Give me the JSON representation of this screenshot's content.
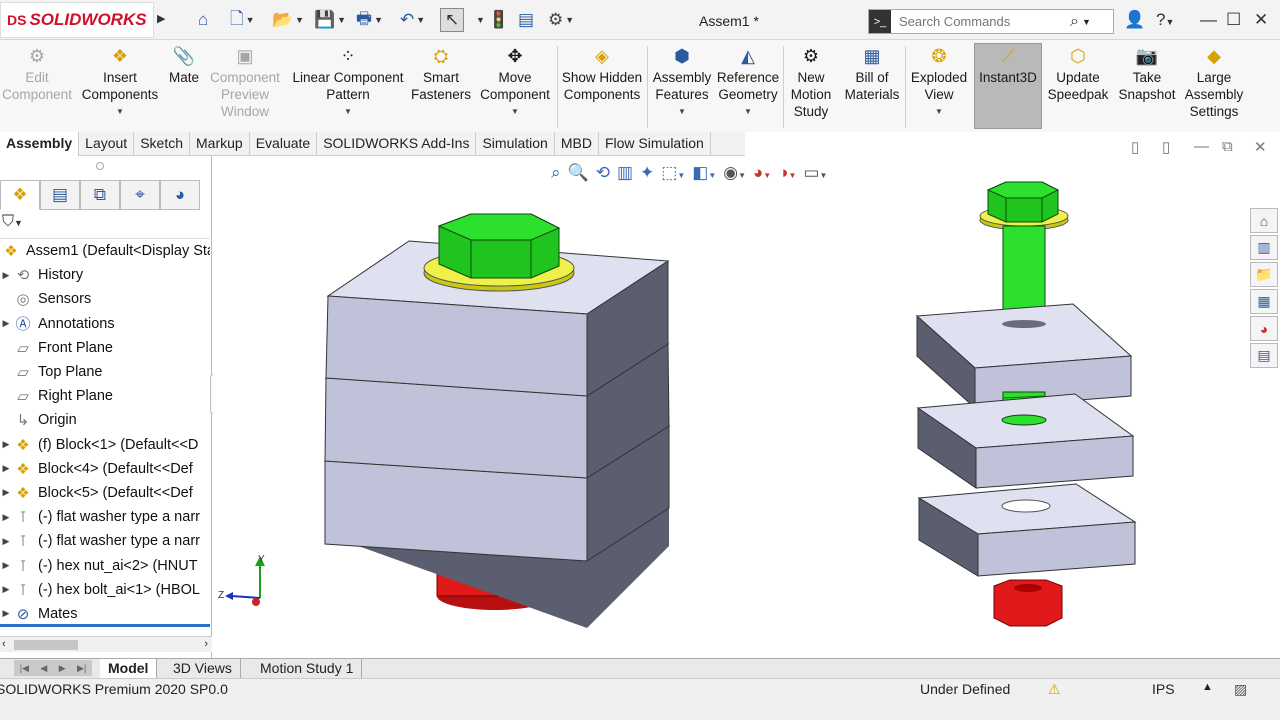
{
  "app": {
    "brand": "SOLIDWORKS",
    "doc_title": "Assem1 *"
  },
  "search": {
    "placeholder": "Search Commands"
  },
  "ribbon": {
    "edit_component": "Edit Component",
    "insert_components": "Insert Components",
    "mate": "Mate",
    "component_preview": "Component Preview Window",
    "linear_pattern": "Linear Component Pattern",
    "smart_fasteners": "Smart Fasteners",
    "move_component": "Move Component",
    "show_hidden": "Show Hidden Components",
    "assembly_features": "Assembly Features",
    "reference_geometry": "Reference Geometry",
    "new_motion_study": "New Motion Study",
    "bill_of_materials": "Bill of Materials",
    "exploded_view": "Exploded View",
    "instant3d": "Instant3D",
    "update_speedpak": "Update Speedpak",
    "take_snapshot": "Take Snapshot",
    "large_assembly": "Large Assembly Settings"
  },
  "tabs": [
    "Assembly",
    "Layout",
    "Sketch",
    "Markup",
    "Evaluate",
    "SOLIDWORKS Add-Ins",
    "Simulation",
    "MBD",
    "Flow Simulation"
  ],
  "tree": {
    "root": "Assem1  (Default<Display Sta",
    "items": [
      {
        "label": "History",
        "icon": "history-icon",
        "exp": true
      },
      {
        "label": "Sensors",
        "icon": "sensor-icon",
        "exp": false
      },
      {
        "label": "Annotations",
        "icon": "annotation-icon",
        "exp": true
      },
      {
        "label": "Front Plane",
        "icon": "plane-icon",
        "exp": false
      },
      {
        "label": "Top Plane",
        "icon": "plane-icon",
        "exp": false
      },
      {
        "label": "Right Plane",
        "icon": "plane-icon",
        "exp": false
      },
      {
        "label": "Origin",
        "icon": "origin-icon",
        "exp": false
      },
      {
        "label": "(f) Block<1> (Default<<D",
        "icon": "part-icon",
        "exp": true
      },
      {
        "label": "Block<4> (Default<<Def",
        "icon": "part-icon",
        "exp": true
      },
      {
        "label": "Block<5> (Default<<Def",
        "icon": "part-icon",
        "exp": true
      },
      {
        "label": "(-) flat washer type a narr",
        "icon": "toolbox-part-icon",
        "exp": true
      },
      {
        "label": "(-) flat washer type a narr",
        "icon": "toolbox-part-icon",
        "exp": true
      },
      {
        "label": "(-) hex nut_ai<2> (HNUT",
        "icon": "toolbox-part-icon",
        "exp": true
      },
      {
        "label": "(-) hex bolt_ai<1> (HBOL",
        "icon": "toolbox-part-icon",
        "exp": true
      },
      {
        "label": "Mates",
        "icon": "mates-icon",
        "exp": true
      }
    ]
  },
  "triad": {
    "x_label": "Z",
    "y_label": "Y"
  },
  "bottom_tabs": [
    "Model",
    "3D Views",
    "Motion Study 1"
  ],
  "status": {
    "product": "SOLIDWORKS Premium 2020 SP0.0",
    "state": "Under Defined",
    "units": "IPS"
  },
  "colors": {
    "block_top": "#dfe1f0",
    "block_front": "#bfc2d9",
    "block_side": "#5b5e6f",
    "bolt": "#2ee02e",
    "washer": "#f0f04a",
    "nut": "#e01a1a"
  }
}
